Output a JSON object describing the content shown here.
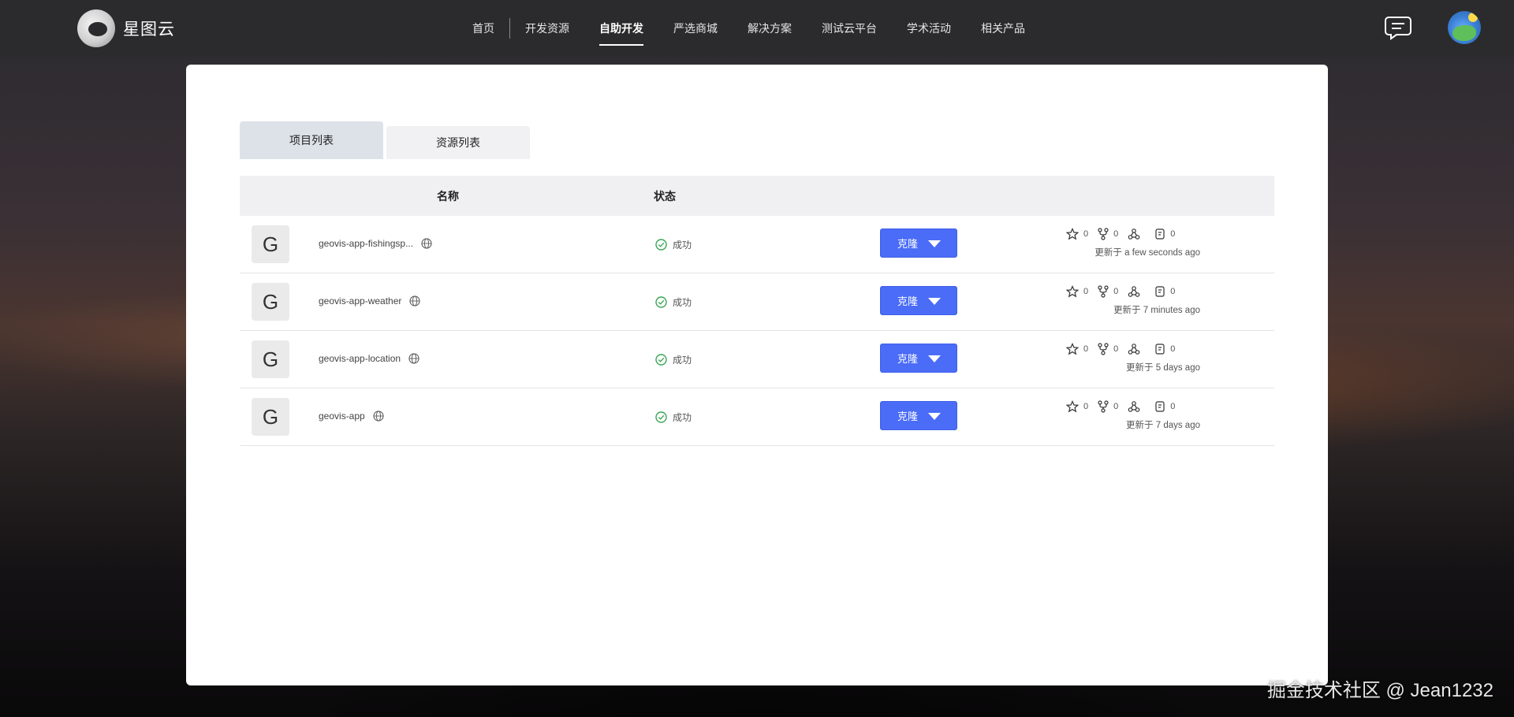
{
  "brand": {
    "name": "星图云"
  },
  "nav": {
    "items": [
      {
        "label": "首页",
        "active": false
      },
      {
        "label": "开发资源",
        "active": false
      },
      {
        "label": "自助开发",
        "active": true
      },
      {
        "label": "严选商城",
        "active": false
      },
      {
        "label": "解决方案",
        "active": false
      },
      {
        "label": "测试云平台",
        "active": false
      },
      {
        "label": "学术活动",
        "active": false
      },
      {
        "label": "相关产品",
        "active": false
      }
    ]
  },
  "tabs": [
    {
      "label": "项目列表",
      "active": true
    },
    {
      "label": "资源列表",
      "active": false
    }
  ],
  "table": {
    "headers": {
      "name": "名称",
      "status": "状态"
    },
    "rows": [
      {
        "badge": "G",
        "name": "geovis-app-fishingsp...",
        "status": "成功",
        "clone_label": "克隆",
        "stars": "0",
        "forks": "0",
        "issues": "0",
        "updated": "更新于 a few seconds ago"
      },
      {
        "badge": "G",
        "name": "geovis-app-weather",
        "status": "成功",
        "clone_label": "克隆",
        "stars": "0",
        "forks": "0",
        "issues": "0",
        "updated": "更新于 7 minutes ago"
      },
      {
        "badge": "G",
        "name": "geovis-app-location",
        "status": "成功",
        "clone_label": "克隆",
        "stars": "0",
        "forks": "0",
        "issues": "0",
        "updated": "更新于 5 days ago"
      },
      {
        "badge": "G",
        "name": "geovis-app",
        "status": "成功",
        "clone_label": "克隆",
        "stars": "0",
        "forks": "0",
        "issues": "0",
        "updated": "更新于 7 days ago"
      }
    ]
  },
  "watermark": "掘金技术社区 @ Jean1232",
  "colors": {
    "accent": "#4a6cf7",
    "success": "#3aa655",
    "topbar": "#2b2b2d"
  },
  "icons": [
    "message-icon",
    "avatar",
    "globe-icon",
    "check-circle-icon",
    "star-icon",
    "fork-icon",
    "merge-icon",
    "issue-icon",
    "caret-down-icon"
  ]
}
